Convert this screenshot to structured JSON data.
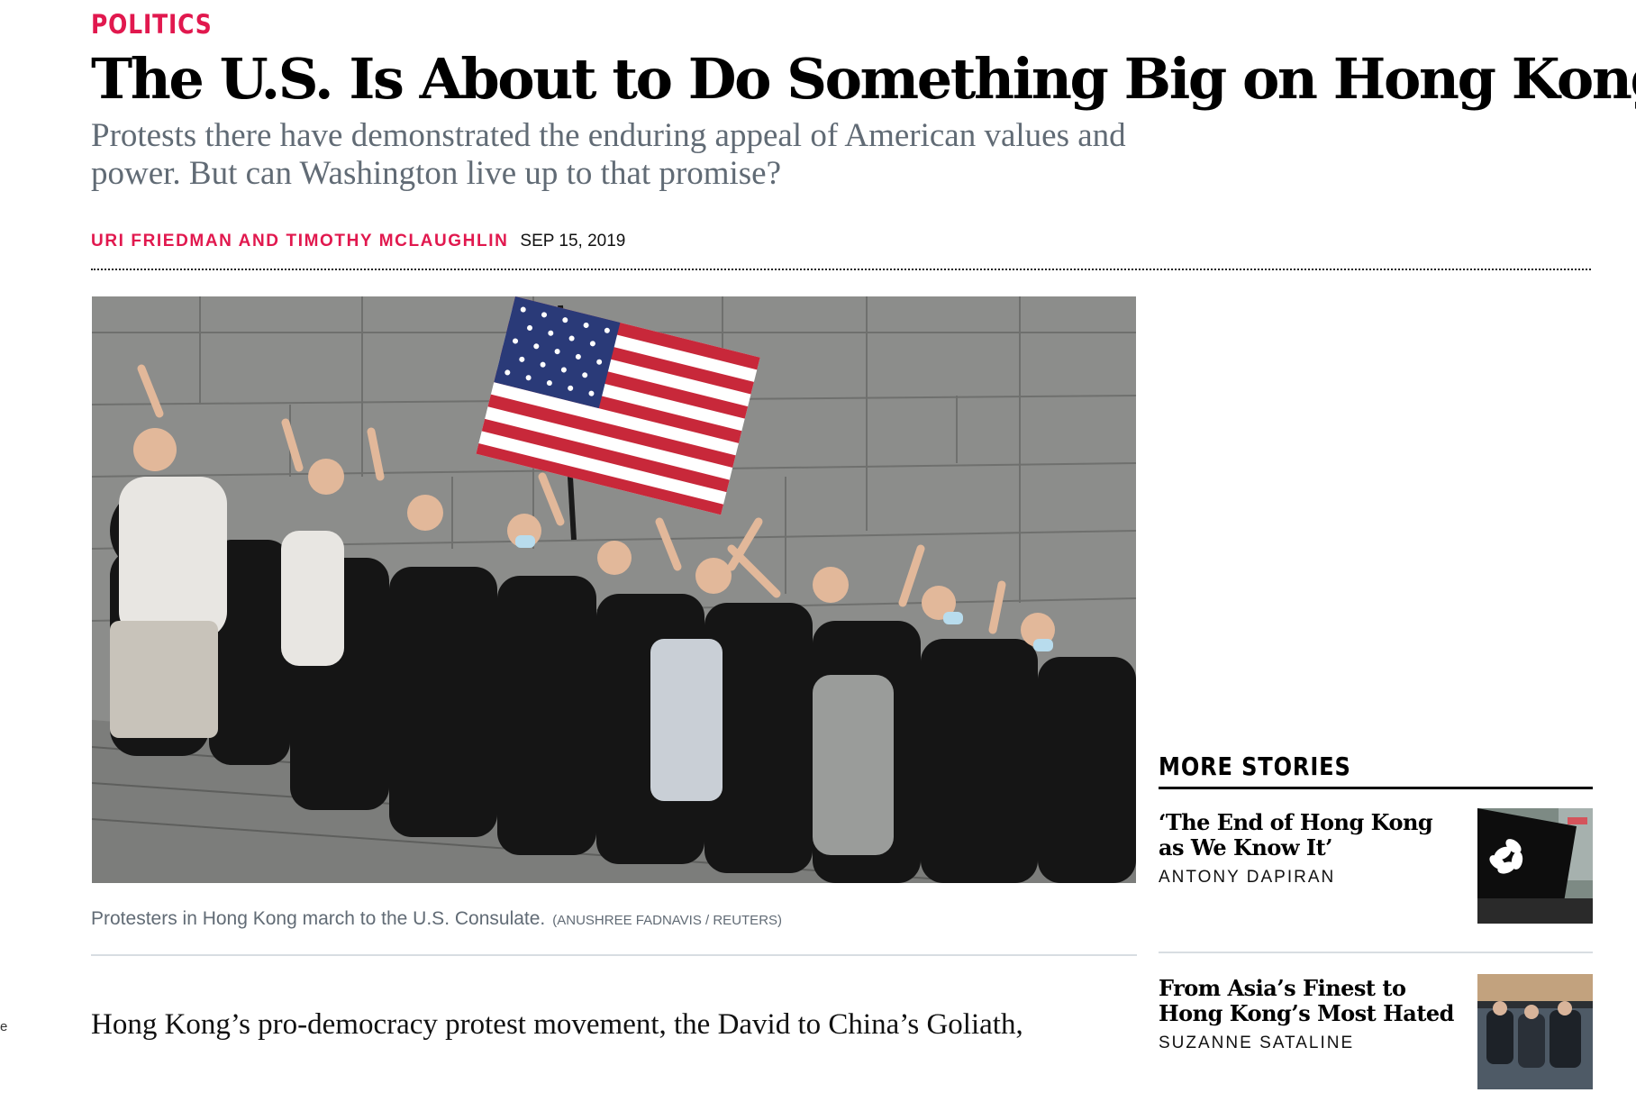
{
  "article": {
    "section": "Politics",
    "headline": "The U.S. Is About to Do Something Big on Hong Kong",
    "dek": "Protests there have demonstrated the enduring appeal of American values and power. But can Washington live up to that promise?",
    "authors": "Uri Friedman and Timothy McLaughlin",
    "date": "SEP 15, 2019",
    "image": {
      "subject": "protesters-with-us-flag-photo"
    },
    "caption": "Protesters in Hong Kong march to the U.S. Consulate.",
    "credit": "(Anushree Fadnavis / Reuters)",
    "body_first_line": "Hong Kong’s pro-democracy protest movement, the David to China’s Goliath,"
  },
  "left_edge_text": "e",
  "more_stories": {
    "title": "More Stories",
    "items": [
      {
        "title": "‘The End of Hong Kong as We Know It’",
        "author": "Antony Dapiran",
        "thumb": "hong-kong-black-flag-photo"
      },
      {
        "title": "From Asia’s Finest to Hong Kong’s Most Hated",
        "author": "Suzanne Sataline",
        "thumb": "hong-kong-police-photo"
      }
    ]
  },
  "colors": {
    "accent": "#e1184e",
    "dek_gray": "#616b75",
    "rule_gray": "#d8dde2"
  }
}
